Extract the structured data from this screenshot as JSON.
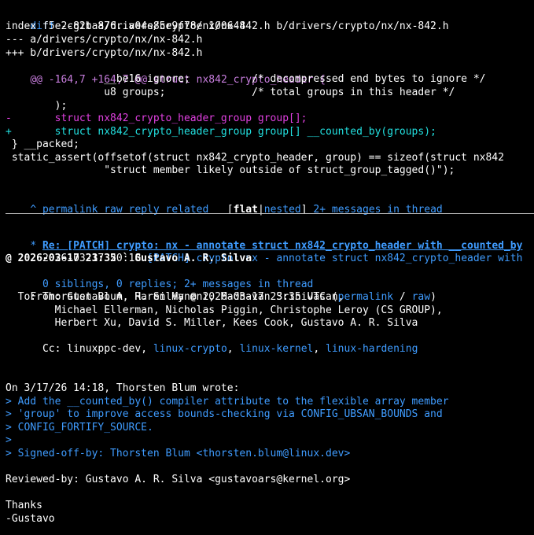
{
  "diff": {
    "header": {
      "keyword": "diff",
      "rest": " --git a/drivers/crypto/nx/nx-842.h b/drivers/crypto/nx/nx-842.h"
    },
    "index": "index f5e2c82ba876..a04e85e9f78e 100644",
    "minus_file": "--- a/drivers/crypto/nx/nx-842.h",
    "plus_file": "+++ b/drivers/crypto/nx/nx-842.h",
    "hunk": {
      "range": "@@ -164,7 +164,7 @@",
      "context": " struct nx842_crypto_header {"
    },
    "context": [
      "                __be16 ignore;          /* decompressed end bytes to ignore */",
      "                u8 groups;              /* total groups in this header */",
      "        );",
      " } __packed;",
      " static_assert(offsetof(struct nx842_crypto_header, group) == sizeof(struct nx842",
      "                \"struct member likely outside of struct_group_tagged()\");"
    ],
    "removed": "-       struct nx842_crypto_header_group group[];",
    "added": "+       struct nx842_crypto_header_group group[] __counted_by(groups);"
  },
  "nav": {
    "permalink": "^ permalink",
    "raw": "raw",
    "reply": "reply",
    "related": "related",
    "bracket_open": "[",
    "flat": "flat",
    "separator": "|",
    "nested": "nested",
    "bracket_close": "]",
    "messages": "2+ messages in thread"
  },
  "message": {
    "star": "* ",
    "subject": "Re: [PATCH] crypto: nx - annotate struct nx842_crypto_header with __counted_by",
    "parent_date": "  2026-03-17 20:18 ",
    "parent_subject": "[PATCH] crypto: nx - annotate struct nx842_crypto_header with",
    "author_line": "@ 2026-03-17 23:35 ` Gustavo A. R. Silva",
    "siblings_indent": "  ",
    "siblings": "0 siblings, 0 replies; 2+ messages in thread"
  },
  "headers": {
    "from": "From: Gustavo A. R. Silva @ 2026-03-17 23:35 UTC (",
    "permalink": "permalink",
    "slash": " / ",
    "raw": "raw",
    "close_paren": ")",
    "to": [
      "  To: Thorsten Blum, Haren Myneni, Madhavan Srinivasan,",
      "        Michael Ellerman, Nicholas Piggin, Christophe Leroy (CS GROUP),",
      "        Herbert Xu, David S. Miller, Kees Cook, Gustavo A. R. Silva"
    ],
    "cc_label": "  Cc: ",
    "comma": ", ",
    "cc": [
      "linuxppc-dev, ",
      "linux-crypto",
      "linux-kernel",
      "linux-hardening"
    ]
  },
  "body": [
    "On 3/17/26 14:18, Thorsten Blum wrote:",
    "> Add the __counted_by() compiler attribute to the flexible array member",
    "> 'group' to improve access bounds-checking via CONFIG_UBSAN_BOUNDS and",
    "> CONFIG_FORTIFY_SOURCE.",
    ">",
    "> Signed-off-by: Thorsten Blum <thorsten.blum@linux.dev>",
    "Reviewed-by: Gustavo A. R. Silva <gustavoars@kernel.org>",
    "Thanks",
    "-Gustavo"
  ],
  "colors": {
    "background": "#000000",
    "link": "#3f9cff",
    "hunk": "#c77ddd",
    "removed": "#e040e0",
    "added": "#22e0e0"
  }
}
